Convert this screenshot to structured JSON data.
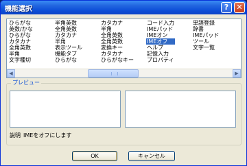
{
  "window": {
    "title": "機能選択",
    "help_glyph": "?",
    "close_glyph": "✕"
  },
  "function_list": {
    "columns": [
      [
        "ひらがな",
        "英数/かな",
        "ひらがな",
        "カタカナ",
        "全角英数",
        "半角",
        "文字種切"
      ],
      [
        "半角英数",
        "全角英数",
        "カタカナ",
        "半角",
        "表示ツール",
        "機能タブ",
        "ひらがな"
      ],
      [
        "カタカナ",
        "半角",
        "全角英数",
        "全角英数",
        "変換キー",
        "カタカナ",
        "ひらがなキー"
      ],
      [
        "コード入力",
        "IMEパッド",
        "IMEオン",
        "IMEオフ",
        "ヘルプ",
        "記憶入力",
        "プロパティ"
      ],
      [
        "単語登録",
        "辞書",
        "IMEパッド",
        "ツール",
        "文字一覧"
      ]
    ],
    "selected": "IMEオフ",
    "scroll_left": "◀",
    "scroll_right": "▶"
  },
  "preview": {
    "label": "プレビュー"
  },
  "description": {
    "label": "説明",
    "text": "IMEをオフにします"
  },
  "buttons": {
    "ok": "OK",
    "cancel": "キャンセル"
  }
}
